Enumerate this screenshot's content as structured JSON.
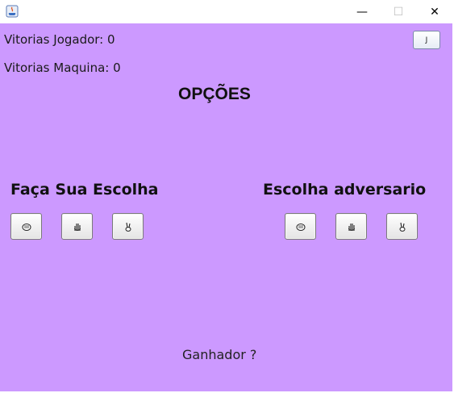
{
  "window": {
    "min_glyph": "—",
    "max_glyph": "☐",
    "close_glyph": "✕"
  },
  "scores": {
    "player_label": "Vitorias Jogador: 0",
    "machine_label": "Vitorias Maquina: 0"
  },
  "header": {
    "title": "OPÇÕES",
    "small_button_label": "J"
  },
  "player": {
    "title": "Faça Sua Escolha",
    "choices": [
      "rock-icon",
      "paper-icon",
      "scissors-icon"
    ]
  },
  "opponent": {
    "title": "Escolha adversario",
    "choices": [
      "rock-icon",
      "paper-icon",
      "scissors-icon"
    ]
  },
  "result": {
    "label": "Ganhador ?"
  },
  "colors": {
    "background": "#cc99ff"
  }
}
